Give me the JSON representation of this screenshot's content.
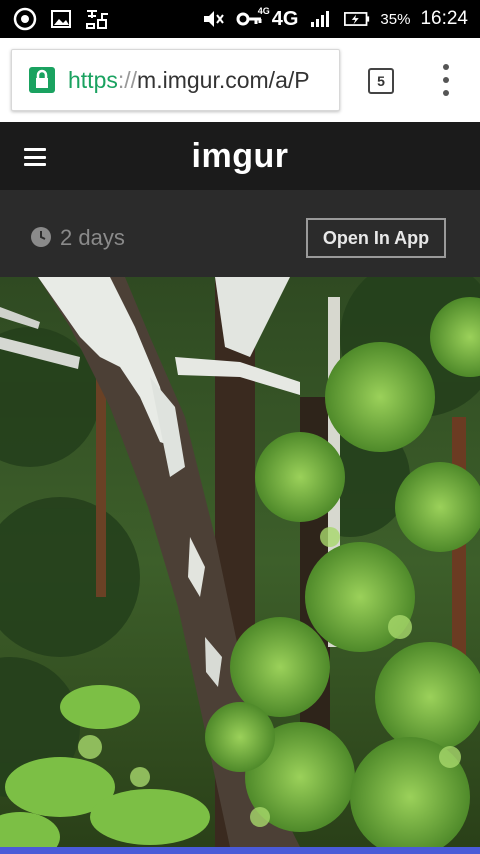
{
  "status_bar": {
    "battery_percent": "35%",
    "time": "16:24",
    "network_label": "4G",
    "network_small": "4G"
  },
  "browser": {
    "url_scheme": "https",
    "url_separator": "://",
    "url_rest": "m.imgur.com/a/P",
    "tab_count": "5"
  },
  "imgur_header": {
    "logo_text": "imgur"
  },
  "post_meta": {
    "age": "2 days",
    "open_in_app_label": "Open In App"
  },
  "colors": {
    "imgur_green": "#85bf25",
    "https_green": "#1aa260",
    "header_bg": "#1b1b1b",
    "meta_bg": "#2b2b2b"
  },
  "icons": [
    "sync-icon",
    "image-icon",
    "vpn-icon",
    "mute-icon",
    "key-icon",
    "signal-icon",
    "battery-icon",
    "lock-icon",
    "clock-icon",
    "hamburger-icon",
    "overflow-menu-icon"
  ]
}
